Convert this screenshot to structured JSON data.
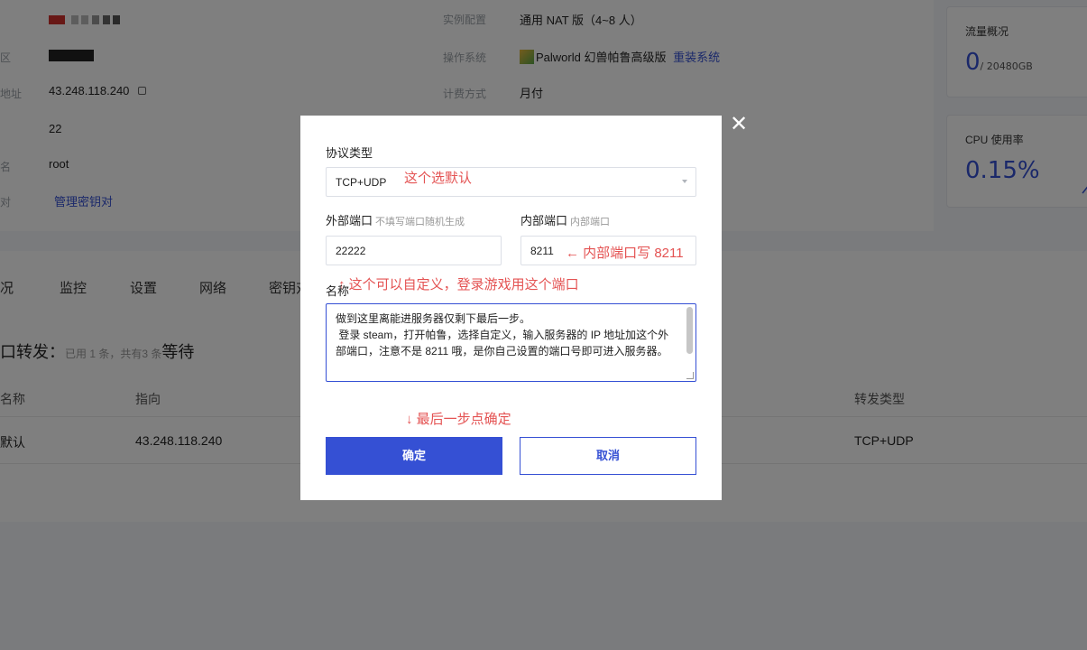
{
  "background": {
    "info": {
      "row1": {
        "label_right": "实例配置",
        "value_right": "通用 NAT 版（4~8 人）"
      },
      "row2": {
        "label_left": "区",
        "label_right": "操作系统",
        "value_right": "Palworld 幻兽帕鲁高级版",
        "reinstall_link": "重装系统"
      },
      "row3": {
        "label_left": "地址",
        "value_left": "43.248.118.240",
        "label_right": "计费方式",
        "value_right": "月付"
      },
      "row4": {
        "value_left": "22"
      },
      "row5": {
        "label_left": "名",
        "value_left": "root"
      },
      "row6": {
        "label_left": "对",
        "link_left": "管理密钥对"
      }
    },
    "cards": {
      "traffic": {
        "title": "流量概况",
        "value": "0",
        "unit": "/ 20480GB"
      },
      "cpu": {
        "title": "CPU 使用率",
        "value": "0.15%"
      }
    },
    "tabs": [
      "况",
      "监控",
      "设置",
      "网络",
      "密钥对"
    ],
    "section": {
      "title": "口转发：",
      "sub": "已用 1 条，共有3 条",
      "note": "等待"
    },
    "table": {
      "headers": {
        "name": "名称",
        "target": "指向",
        "type": "转发类型"
      },
      "row": {
        "name": "默认",
        "target": "43.248.118.240",
        "type": "TCP+UDP"
      }
    },
    "colors": {
      "accent": "#3550d4",
      "annotation": "#e45353"
    }
  },
  "modal": {
    "protocol_label": "协议类型",
    "protocol_value": "TCP+UDP",
    "protocol_annotation": "这个选默认",
    "external_port_label": "外部端口",
    "external_port_hint": "不填写端口随机生成",
    "external_port_value": "22222",
    "internal_port_label": "内部端口",
    "internal_port_hint": "内部端口",
    "internal_port_value": "8211",
    "internal_port_annotation": "← 内部端口写 8211",
    "external_annotation": "↑ 这个可以自定义，登录游戏用这个端口",
    "name_label": "名称",
    "name_value": "做到这里离能进服务器仅剩下最后一步。\n 登录 steam，打开帕鲁，选择自定义，输入服务器的 IP 地址加这个外部端口，注意不是 8211 哦，是你自己设置的端口号即可进入服务器。",
    "confirm_annotation": "↓ 最后一步点确定",
    "confirm_label": "确定",
    "cancel_label": "取消",
    "close_icon": "✕"
  }
}
